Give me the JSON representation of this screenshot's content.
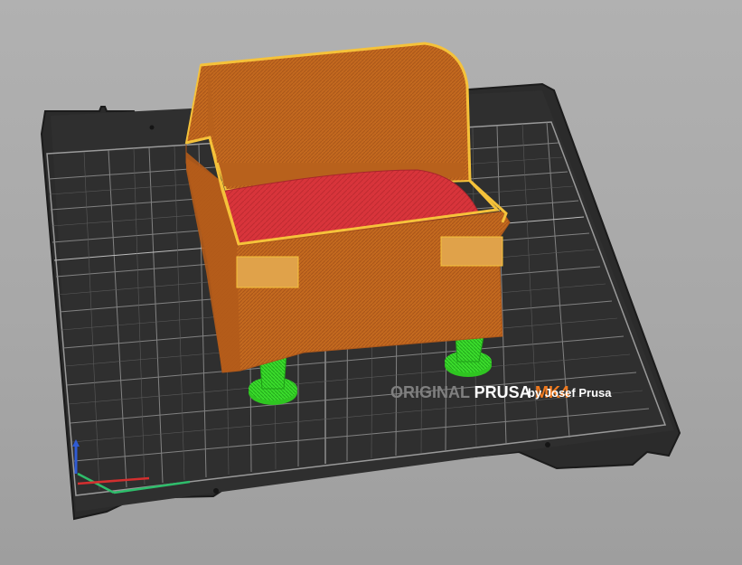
{
  "viewport": {
    "background_color": "#a9a9a9",
    "bed_color": "#2d2d2d",
    "grid_color": "#8a8a8a",
    "model_color": "#c46a1f",
    "model_edge_color": "#f5c23a",
    "model_floor_color": "#d8343b",
    "support_color": "#3bdc2c"
  },
  "bed": {
    "logo_part1": "ORIGINAL ",
    "logo_part2": "PRUSA ",
    "logo_part3": "MK4",
    "byline": "by Josef Prusa",
    "logo_gray": "#7f7f7f",
    "logo_white": "#ffffff",
    "logo_orange": "#f07a1f"
  },
  "axes": {
    "x_color": "#d32f2f",
    "y_color": "#2ebd6b",
    "z_color": "#2f5bd3"
  }
}
